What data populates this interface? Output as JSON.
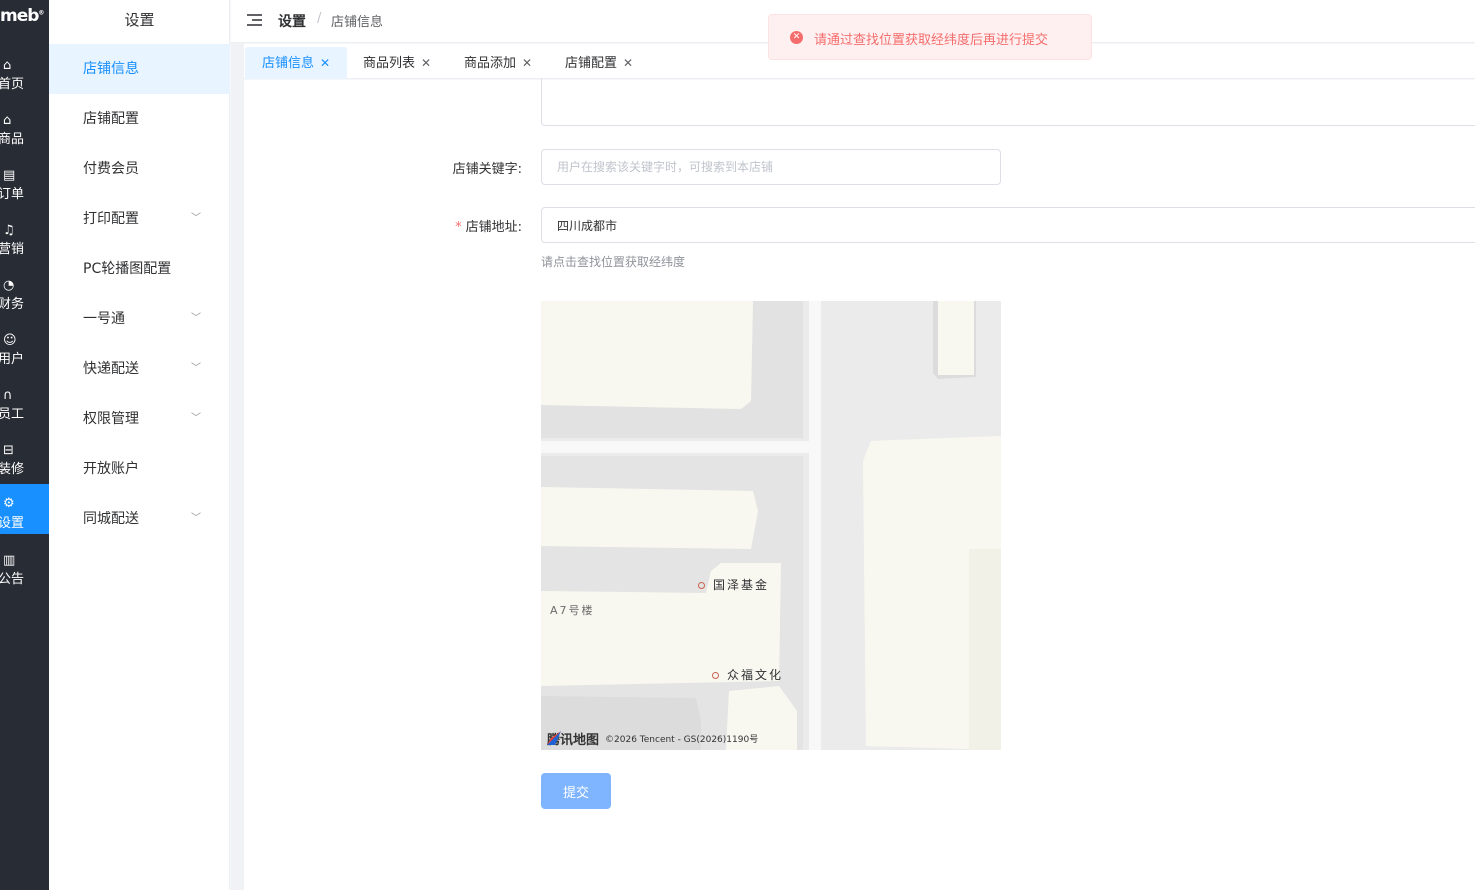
{
  "app": {
    "logo": "meb"
  },
  "rail": {
    "items": [
      {
        "label": "首页",
        "icon": "home-icon"
      },
      {
        "label": "商品",
        "icon": "bag-icon"
      },
      {
        "label": "订单",
        "icon": "order-icon"
      },
      {
        "label": "营销",
        "icon": "bell-icon"
      },
      {
        "label": "财务",
        "icon": "pie-icon"
      },
      {
        "label": "用户",
        "icon": "user-icon"
      },
      {
        "label": "员工",
        "icon": "headset-icon"
      },
      {
        "label": "装修",
        "icon": "decor-icon"
      },
      {
        "label": "设置",
        "icon": "gear-icon"
      },
      {
        "label": "公告",
        "icon": "notice-icon"
      }
    ],
    "active_index": 8
  },
  "sidebar": {
    "title": "设置",
    "items": [
      {
        "label": "店铺信息"
      },
      {
        "label": "店铺配置"
      },
      {
        "label": "付费会员"
      },
      {
        "label": "打印配置"
      },
      {
        "label": "PC轮播图配置"
      },
      {
        "label": "一号通"
      },
      {
        "label": "快递配送"
      },
      {
        "label": "权限管理"
      },
      {
        "label": "开放账户"
      },
      {
        "label": "同城配送"
      }
    ]
  },
  "header": {
    "breadcrumb_root": "设置",
    "breadcrumb_sep": "/",
    "breadcrumb_current": "店铺信息"
  },
  "tabs": [
    {
      "label": "店铺信息"
    },
    {
      "label": "商品列表"
    },
    {
      "label": "商品添加"
    },
    {
      "label": "店铺配置"
    }
  ],
  "form": {
    "keyword_label": "店铺关键字:",
    "keyword_placeholder": "用户在搜索该关键字时，可搜索到本店铺",
    "keyword_value": "",
    "address_label": "店铺地址:",
    "address_value": "四川成都市",
    "address_hint": "请点击查找位置获取经纬度",
    "submit_label": "提交"
  },
  "map": {
    "pois": [
      "国泽基金",
      "众福文化"
    ],
    "building_label": "A7号楼",
    "brand": "腾讯地图",
    "copyright": "©2026 Tencent - GS(2026)1190号"
  },
  "toast": {
    "message": "请通过查找位置获取经纬度后再进行提交",
    "type": "error",
    "color": "#f56c6c"
  },
  "colors": {
    "primary": "#1890ff",
    "rail_bg": "#282c34",
    "submit_bg": "#7fb5ff"
  }
}
